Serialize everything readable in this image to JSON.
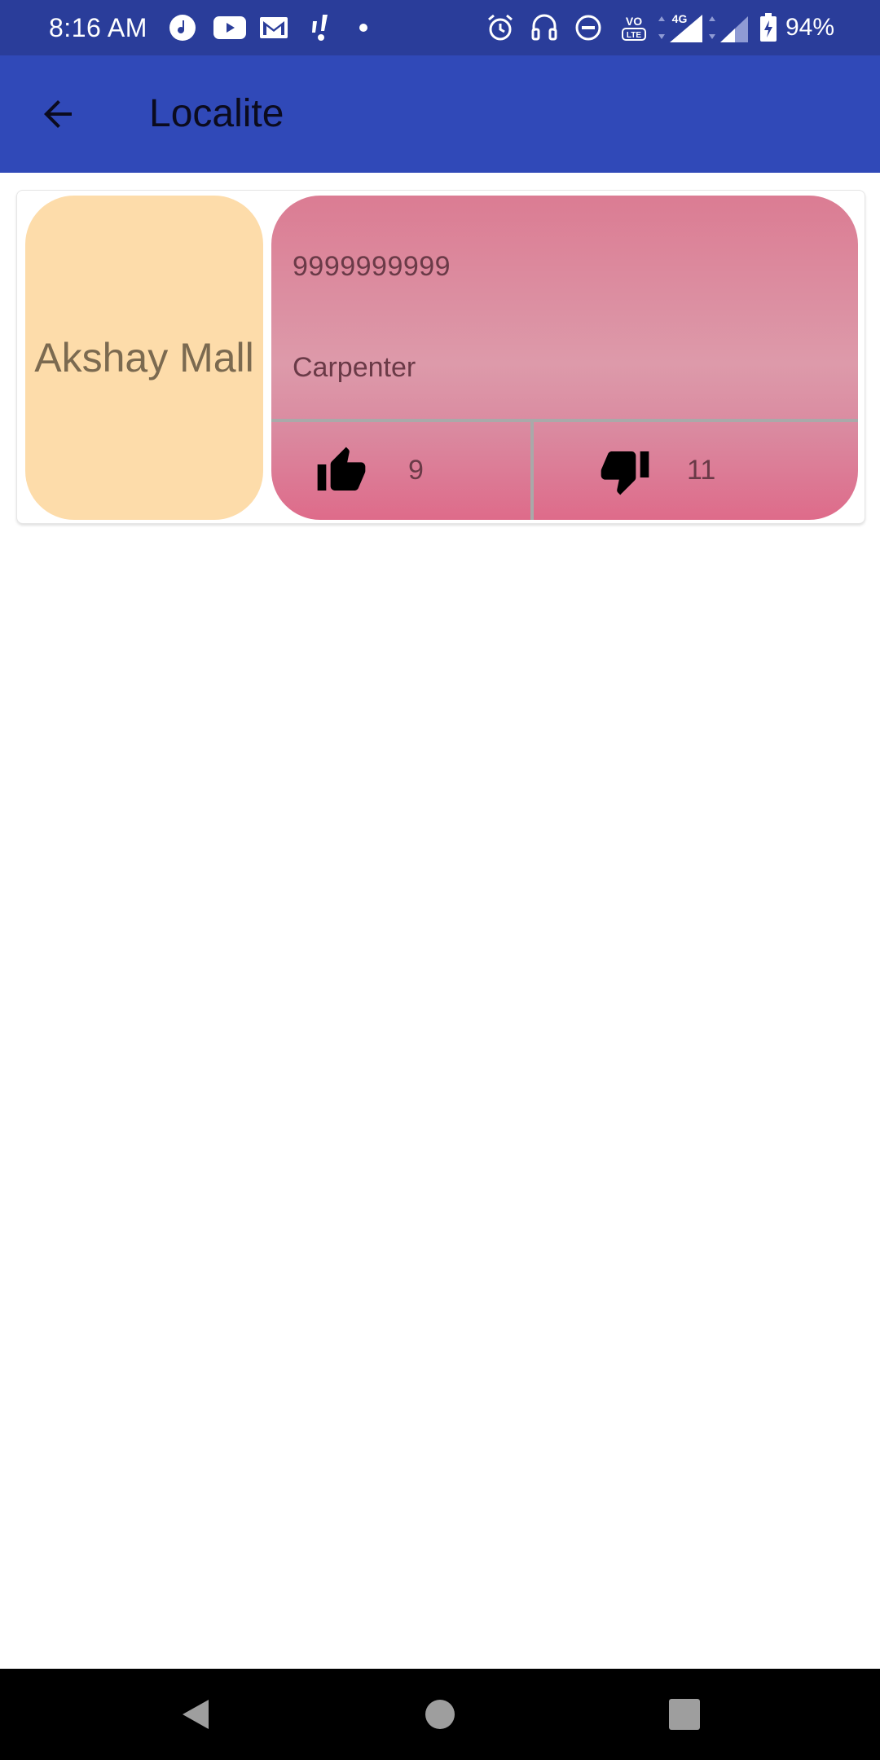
{
  "status_bar": {
    "time": "8:16 AM",
    "battery_percent": "94%",
    "network_type": "4G",
    "volte_label": "VO LTE",
    "icons": [
      "music-icon",
      "youtube-icon",
      "gmail-icon",
      "notification-icon",
      "dot-icon",
      "alarm-icon",
      "headset-icon",
      "dnd-icon",
      "volte-icon",
      "signal-icon",
      "signal-icon-2",
      "battery-icon"
    ]
  },
  "app_bar": {
    "title": "Localite",
    "back_icon": "arrow-back-icon"
  },
  "card": {
    "name": "Akshay Mall",
    "phone": "9999999999",
    "profession": "Carpenter",
    "likes": "9",
    "dislikes": "11",
    "like_icon": "thumbs-up-icon",
    "dislike_icon": "thumbs-down-icon",
    "colors": {
      "name_tile": "#fddcaa",
      "info_tile": "#dd8fa3",
      "app_bar": "#3049b8",
      "status_bar": "#2a3d9a"
    }
  },
  "nav_bar": {
    "back": "nav-back-icon",
    "home": "nav-home-icon",
    "recents": "nav-recents-icon"
  }
}
